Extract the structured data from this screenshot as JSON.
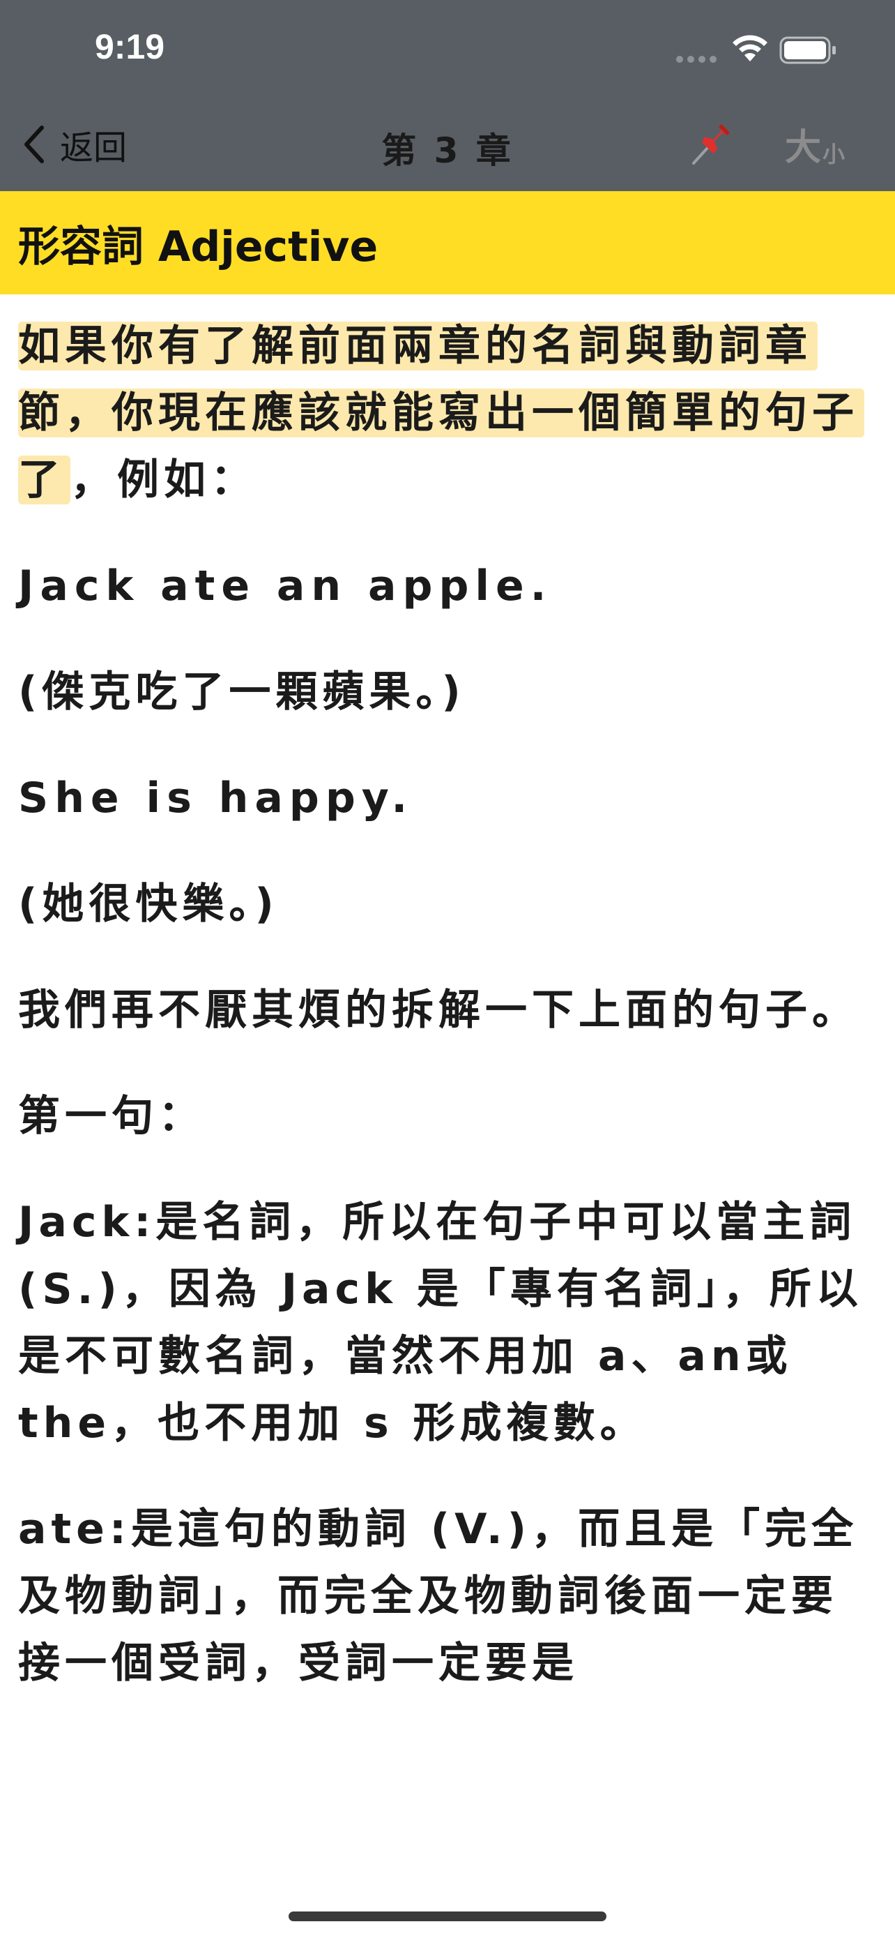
{
  "status_bar": {
    "time": "9:19"
  },
  "nav": {
    "back_label": "返回",
    "title": "第 3 章",
    "pin_icon": "pin-icon",
    "font_size_big": "大",
    "font_size_small": "小"
  },
  "chapter": {
    "heading": "形容詞 Adjective"
  },
  "content": {
    "intro_highlighted": "如果你有了解前面兩章的名詞與動詞章節，你現在應該就能寫出一個簡單的句子了",
    "intro_rest": "，例如：",
    "example1_en": "Jack ate an apple.",
    "example1_zh": "(傑克吃了一顆蘋果。)",
    "example2_en": "She is happy.",
    "example2_zh": "(她很快樂。)",
    "para_analyze": "我們再不厭其煩的拆解一下上面的句子。",
    "first_sentence": "第一句：",
    "jack_explain": "Jack:是名詞，所以在句子中可以當主詞 (S.)，因為 Jack 是「專有名詞」，所以是不可數名詞，當然不用加 a、an或the，也不用加 s 形成複數。",
    "ate_explain": "ate:是這句的動詞 (V.)，而且是「完全及物動詞」，而完全及物動詞後面一定要接一個受詞，受詞一定要是"
  },
  "colors": {
    "topbar": "#585e63",
    "chapter_header": "#ffdd25",
    "highlight": "#fde9ad"
  }
}
